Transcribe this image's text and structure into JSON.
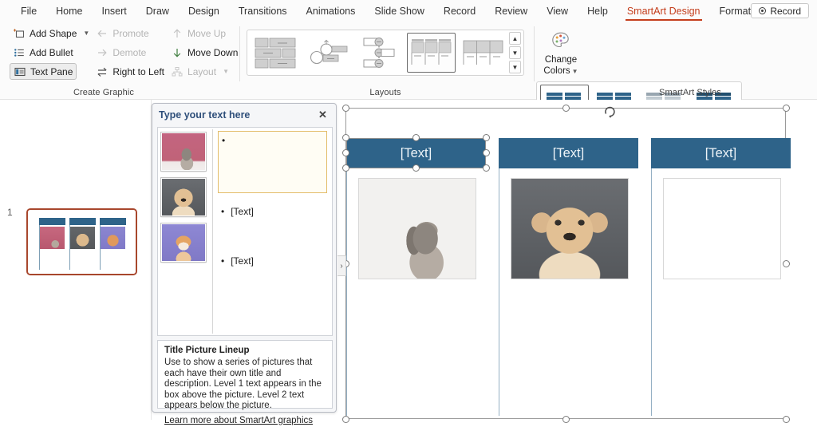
{
  "menu": {
    "tabs": [
      {
        "label": "File",
        "active": false
      },
      {
        "label": "Home",
        "active": false
      },
      {
        "label": "Insert",
        "active": false
      },
      {
        "label": "Draw",
        "active": false
      },
      {
        "label": "Design",
        "active": false
      },
      {
        "label": "Transitions",
        "active": false
      },
      {
        "label": "Animations",
        "active": false
      },
      {
        "label": "Slide Show",
        "active": false
      },
      {
        "label": "Record",
        "active": false
      },
      {
        "label": "Review",
        "active": false
      },
      {
        "label": "View",
        "active": false
      },
      {
        "label": "Help",
        "active": false
      },
      {
        "label": "SmartArt Design",
        "active": true
      },
      {
        "label": "Format",
        "active": false
      }
    ],
    "record_button": "Record",
    "active_tab_color": "#c43e1c"
  },
  "ribbon": {
    "create_graphic": {
      "label": "Create Graphic",
      "items": [
        {
          "label": "Add Shape",
          "icon": "add-shape-icon",
          "enabled": true,
          "has_caret": true
        },
        {
          "label": "Add Bullet",
          "icon": "add-bullet-icon",
          "enabled": true,
          "has_caret": false
        },
        {
          "label": "Text Pane",
          "icon": "text-pane-icon",
          "enabled": true,
          "toggled": true,
          "has_caret": false
        },
        {
          "label": "Promote",
          "icon": "arrow-left-icon",
          "enabled": false,
          "has_caret": false
        },
        {
          "label": "Demote",
          "icon": "arrow-right-icon",
          "enabled": false,
          "has_caret": false
        },
        {
          "label": "Right to Left",
          "icon": "swap-arrows-icon",
          "enabled": true,
          "has_caret": false
        },
        {
          "label": "Move Up",
          "icon": "arrow-up-icon",
          "enabled": false,
          "has_caret": false
        },
        {
          "label": "Move Down",
          "icon": "arrow-down-icon",
          "enabled": true,
          "has_caret": false
        },
        {
          "label": "Layout",
          "icon": "org-layout-icon",
          "enabled": false,
          "has_caret": true
        }
      ]
    },
    "layouts": {
      "label": "Layouts",
      "selected_index": 3,
      "thumbnails": [
        "layout-blocks",
        "layout-circle-arrow",
        "layout-vertical-process",
        "layout-title-picture-lineup",
        "layout-picture-strips"
      ],
      "scroll_up": "scroll-up",
      "scroll_down": "scroll-down",
      "more": "more-layouts"
    },
    "smartart_styles": {
      "label": "SmartArt Styles",
      "change_colors": {
        "line1": "Change",
        "line2": "Colors",
        "icon": "color-palette-icon"
      },
      "selected_index": 0,
      "thumbnails": [
        "style-simple-fill",
        "style-subtle-effect",
        "style-gradient",
        "style-intense-effect"
      ]
    }
  },
  "slide_panel": {
    "slide_number": "1",
    "selected": true,
    "border_color": "#a8472d"
  },
  "canvas": {
    "smartart": {
      "name": "Title Picture Lineup",
      "title_bar_color": "#2e6389",
      "cards": [
        {
          "title": "[Text]",
          "photo": "rabbit-on-pink",
          "bg": "#c7687f",
          "selected": true
        },
        {
          "title": "[Text]",
          "photo": "dog-on-gray",
          "bg": "#606469",
          "selected": false
        },
        {
          "title": "[Text]",
          "photo": "kitten-on-purple",
          "bg": "#8b86d0",
          "selected": false
        }
      ]
    }
  },
  "text_pane": {
    "header": "Type your text here",
    "close_icon": "close-icon",
    "expand_icon": "chevron-right-icon",
    "thumbnails": [
      "rabbit-on-pink",
      "dog-on-gray",
      "kitten-on-purple"
    ],
    "lines": [
      {
        "text": "",
        "active": true
      },
      {
        "text": "[Text]",
        "active": false
      },
      {
        "text": "[Text]",
        "active": false
      }
    ],
    "description": {
      "title": "Title Picture Lineup",
      "body": "Use to show a series of pictures that each have their own title and description. Level 1 text appears in the box above the picture. Level 2 text appears below the picture.",
      "link": "Learn more about SmartArt graphics"
    }
  }
}
